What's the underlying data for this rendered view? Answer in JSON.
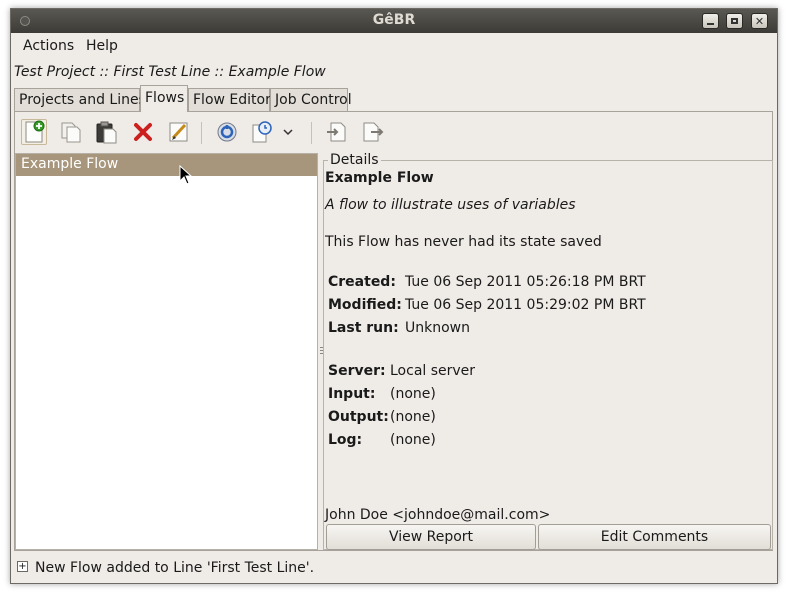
{
  "window": {
    "title": "GêBR"
  },
  "menubar": {
    "actions": "Actions",
    "help": "Help"
  },
  "breadcrumb": "Test Project :: First Test Line :: Example Flow",
  "tabs": [
    "Projects and Lines",
    "Flows",
    "Flow Editor",
    "Job Control"
  ],
  "active_tab": "Flows",
  "toolbar": {
    "icons": [
      "new-flow-icon",
      "copy-icon",
      "paste-icon",
      "delete-icon",
      "edit-icon",
      "execute-icon",
      "schedule-icon",
      "dropdown-chevron-icon",
      "import-icon",
      "export-icon"
    ]
  },
  "flows_list": {
    "items": [
      "Example Flow"
    ],
    "selected": 0
  },
  "details": {
    "legend": "Details",
    "title": "Example Flow",
    "description": "A flow to illustrate uses of variables",
    "state": "This Flow has never had its state saved",
    "created_label": "Created:",
    "created_value": "Tue 06 Sep 2011 05:26:18 PM BRT",
    "modified_label": "Modified:",
    "modified_value": "Tue 06 Sep 2011 05:29:02 PM BRT",
    "lastrun_label": "Last run:",
    "lastrun_value": "Unknown",
    "server_label": "Server:",
    "server_value": "Local server",
    "input_label": "Input:",
    "input_value": "(none)",
    "output_label": "Output:",
    "output_value": "(none)",
    "log_label": "Log:",
    "log_value": "(none)",
    "author": "John Doe <johndoe@mail.com>",
    "view_report": "View Report",
    "edit_comments": "Edit Comments"
  },
  "statusbar": {
    "expander": "+",
    "message": "New Flow added to Line 'First Test Line'."
  },
  "colors": {
    "selection": "#a8967c",
    "window_bg": "#efebe7",
    "titlebar": "#3c3b37",
    "delete": "#cc1f1f"
  }
}
